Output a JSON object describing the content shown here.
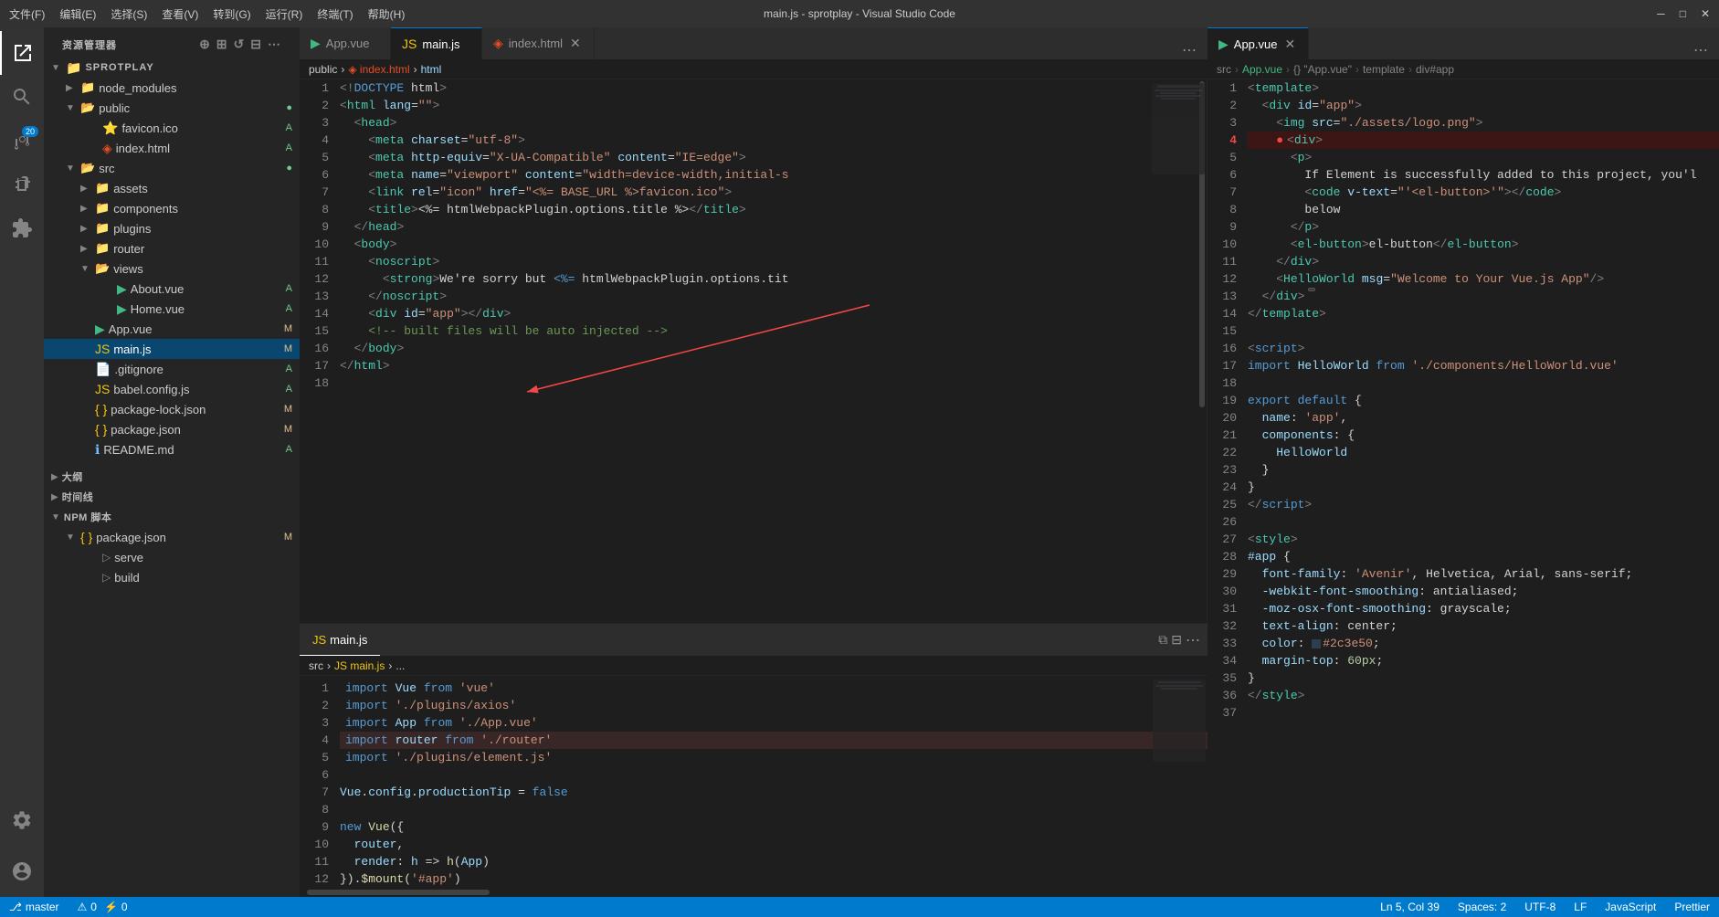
{
  "titlebar": {
    "menu": [
      "文件(F)",
      "编辑(E)",
      "选择(S)",
      "查看(V)",
      "转到(G)",
      "运行(R)",
      "终端(T)",
      "帮助(H)"
    ],
    "title": "main.js - sprotplay - Visual Studio Code",
    "controls": [
      "─",
      "□",
      "✕"
    ]
  },
  "sidebar": {
    "header": "资源管理器",
    "project": "SPROTPLAY",
    "tree": [
      {
        "label": "node_modules",
        "type": "folder",
        "indent": 1,
        "collapsed": true
      },
      {
        "label": "public",
        "type": "folder",
        "indent": 1,
        "collapsed": false,
        "badge": "",
        "badgeColor": "green"
      },
      {
        "label": "favicon.ico",
        "type": "file-ico",
        "indent": 2,
        "letter": "A",
        "letterColor": "green"
      },
      {
        "label": "index.html",
        "type": "file-html",
        "indent": 2,
        "letter": "A",
        "letterColor": "green"
      },
      {
        "label": "src",
        "type": "folder",
        "indent": 1,
        "collapsed": false,
        "badge": "",
        "badgeColor": "green"
      },
      {
        "label": "assets",
        "type": "folder",
        "indent": 2,
        "collapsed": true
      },
      {
        "label": "components",
        "type": "folder",
        "indent": 2,
        "collapsed": true
      },
      {
        "label": "plugins",
        "type": "folder",
        "indent": 2,
        "collapsed": true
      },
      {
        "label": "router",
        "type": "folder",
        "indent": 2,
        "collapsed": true
      },
      {
        "label": "views",
        "type": "folder",
        "indent": 2,
        "collapsed": false
      },
      {
        "label": "About.vue",
        "type": "file-vue",
        "indent": 3,
        "letter": "A",
        "letterColor": "green"
      },
      {
        "label": "Home.vue",
        "type": "file-vue",
        "indent": 3,
        "letter": "A",
        "letterColor": "green"
      },
      {
        "label": "App.vue",
        "type": "file-vue",
        "indent": 2,
        "letter": "M",
        "letterColor": "yellow"
      },
      {
        "label": "main.js",
        "type": "file-js",
        "indent": 2,
        "letter": "M",
        "letterColor": "yellow",
        "active": true
      },
      {
        "label": ".gitignore",
        "type": "file",
        "indent": 2,
        "letter": "A",
        "letterColor": "green"
      },
      {
        "label": "babel.config.js",
        "type": "file-js",
        "indent": 2,
        "letter": "A",
        "letterColor": "green"
      },
      {
        "label": "package-lock.json",
        "type": "file-json",
        "indent": 2,
        "letter": "M",
        "letterColor": "yellow"
      },
      {
        "label": "package.json",
        "type": "file-json",
        "indent": 2,
        "letter": "M",
        "letterColor": "yellow"
      },
      {
        "label": "README.md",
        "type": "file-md",
        "indent": 2,
        "letter": "A",
        "letterColor": "green"
      }
    ],
    "sections": [
      {
        "label": "大纲",
        "collapsed": true
      },
      {
        "label": "时间线",
        "collapsed": true
      },
      {
        "label": "NPM 脚本",
        "collapsed": false
      }
    ],
    "npm_items": [
      {
        "label": "package.json",
        "badge": "M",
        "badgeColor": "yellow"
      },
      {
        "label": "serve"
      },
      {
        "label": "build"
      }
    ]
  },
  "editor": {
    "tabs": [
      {
        "label": "App.vue",
        "icon": "vue",
        "active": false,
        "color": "#42b883"
      },
      {
        "label": "main.js",
        "icon": "js",
        "active": true,
        "color": "#f1c40f"
      },
      {
        "label": "index.html",
        "icon": "html",
        "active": false,
        "color": "#e44d26",
        "closeable": true
      }
    ],
    "breadcrumb": [
      "public",
      ">",
      "index.html",
      ">",
      "html"
    ],
    "index_html": {
      "lines": [
        "<!DOCTYPE html>",
        "<html lang=\"\">",
        "  <head>",
        "    <meta charset=\"utf-8\">",
        "    <meta http-equiv=\"X-UA-Compatible\" content=\"IE=edge\">",
        "    <meta name=\"viewport\" content=\"width=device-width,initial-s",
        "    <link rel=\"icon\" href=\"<%= BASE_URL %>favicon.ico\">",
        "    <title><%= htmlWebpackPlugin.options.title %></title>",
        "  </head>",
        "  <body>",
        "    <noscript>",
        "      <strong>We're sorry but <%= htmlWebpackPlugin.options.tit",
        "    </noscript>",
        "    <div id=\"app\"></div>",
        "    <!-- built files will be auto injected -->",
        "  </body>",
        "</html>",
        ""
      ]
    }
  },
  "bottom_panel": {
    "tab_label": "main.js",
    "breadcrumb": [
      "src",
      ">",
      "JS main.js",
      ">",
      "..."
    ],
    "main_js": {
      "lines": [
        "import Vue from 'vue'",
        "import './plugins/axios'",
        "import App from './App.vue'",
        "import router from './router'",
        "import './plugins/element.js'",
        "",
        "Vue.config.productionTip = false",
        "",
        "new Vue({",
        "  router,",
        "  render: h => h(App)",
        "}).$mount('#app')",
        ""
      ]
    }
  },
  "right_pane": {
    "tab_label": "App.vue",
    "breadcrumb": [
      "src",
      ">",
      "App.vue",
      ">",
      "{} \"App.vue\"",
      ">",
      "template",
      ">",
      "div#app"
    ],
    "app_vue": {
      "lines": [
        "<template>",
        "  <div id=\"app\">",
        "    <img src=\"./assets/logo.png\">",
        "    <div>",
        "      <p>",
        "        If Element is successfully added to this project, you'll",
        "        <code v-text=\"'<el-button>'\"></code>",
        "        below",
        "      </p>",
        "      <el-button>el-button</el-button>",
        "    </div>",
        "    <HelloWorld msg=\"Welcome to Your Vue.js App\"/>",
        "  </div>",
        "</template>",
        "",
        "<script>",
        "import HelloWorld from './components/HelloWorld.vue'",
        "",
        "export default {",
        "  name: 'app',",
        "  components: {",
        "    HelloWorld",
        "  }",
        "}",
        "</script>",
        "",
        "<style>",
        "#app {",
        "  font-family: 'Avenir', Helvetica, Arial, sans-serif;",
        "  -webkit-font-smoothing: antialiased;",
        "  -moz-osx-font-smoothing: grayscale;",
        "  text-align: center;",
        "  color: #2c3e50;",
        "  margin-top: 60px;",
        "}",
        "</style>"
      ]
    }
  },
  "statusbar": {
    "left": [
      "⎇ master",
      "⚠ 0",
      "⚡ 0"
    ],
    "right": [
      "Ln 5, Col 39",
      "Spaces: 2",
      "UTF-8",
      "LF",
      "JavaScript",
      "Prettier"
    ]
  }
}
